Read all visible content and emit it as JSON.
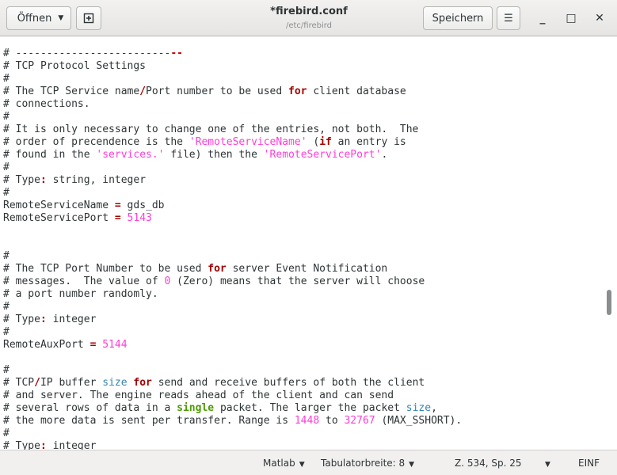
{
  "header": {
    "open_label": "Öffnen",
    "open_caret": "▼",
    "new_tab_icon": "new-document-icon",
    "title": "*firebird.conf",
    "subtitle": "/etc/firebird",
    "save_label": "Speichern",
    "menu_glyph": "☰",
    "minimize_glyph": "_",
    "maximize_glyph": "□",
    "close_glyph": "✕"
  },
  "editor": {
    "lines": [
      [
        {
          "t": "# -------------------------"
        },
        {
          "t": "--",
          "c": "kw-dash"
        }
      ],
      [
        {
          "t": "# TCP Protocol Settings"
        }
      ],
      [
        {
          "t": "#"
        }
      ],
      [
        {
          "t": "# The TCP Service name"
        },
        {
          "t": "/",
          "c": "op"
        },
        {
          "t": "Port number to be used "
        },
        {
          "t": "for",
          "c": "kw-red"
        },
        {
          "t": " client database"
        }
      ],
      [
        {
          "t": "# connections."
        }
      ],
      [
        {
          "t": "#"
        }
      ],
      [
        {
          "t": "# It is only necessary to change one of the entries, not both.  The"
        }
      ],
      [
        {
          "t": "# order of precendence is the "
        },
        {
          "t": "'RemoteServiceName'",
          "c": "str"
        },
        {
          "t": " ("
        },
        {
          "t": "if",
          "c": "kw-red"
        },
        {
          "t": " an entry is"
        }
      ],
      [
        {
          "t": "# found in the "
        },
        {
          "t": "'services.'",
          "c": "str"
        },
        {
          "t": " file) then the "
        },
        {
          "t": "'RemoteServicePort'",
          "c": "str"
        },
        {
          "t": "."
        }
      ],
      [
        {
          "t": "#"
        }
      ],
      [
        {
          "t": "# Type"
        },
        {
          "t": ":",
          "c": "op"
        },
        {
          "t": " string, integer"
        }
      ],
      [
        {
          "t": "#"
        }
      ],
      [
        {
          "t": "RemoteServiceName "
        },
        {
          "t": "=",
          "c": "op"
        },
        {
          "t": " gds_db"
        }
      ],
      [
        {
          "t": "RemoteServicePort "
        },
        {
          "t": "=",
          "c": "op"
        },
        {
          "t": " "
        },
        {
          "t": "5143",
          "c": "num"
        }
      ],
      [
        {
          "t": ""
        }
      ],
      [
        {
          "t": ""
        }
      ],
      [
        {
          "t": "#"
        }
      ],
      [
        {
          "t": "# The TCP Port Number to be used "
        },
        {
          "t": "for",
          "c": "kw-red"
        },
        {
          "t": " server Event Notification"
        }
      ],
      [
        {
          "t": "# messages.  The value of "
        },
        {
          "t": "0",
          "c": "num"
        },
        {
          "t": " (Zero) means that the server will choose"
        }
      ],
      [
        {
          "t": "# a port number randomly."
        }
      ],
      [
        {
          "t": "#"
        }
      ],
      [
        {
          "t": "# Type"
        },
        {
          "t": ":",
          "c": "op"
        },
        {
          "t": " integer"
        }
      ],
      [
        {
          "t": "#"
        }
      ],
      [
        {
          "t": "RemoteAuxPort "
        },
        {
          "t": "=",
          "c": "op"
        },
        {
          "t": " "
        },
        {
          "t": "5144",
          "c": "num"
        }
      ],
      [
        {
          "t": ""
        }
      ],
      [
        {
          "t": "#"
        }
      ],
      [
        {
          "t": "# TCP"
        },
        {
          "t": "/",
          "c": "op"
        },
        {
          "t": "IP buffer "
        },
        {
          "t": "size",
          "c": "kw-blue"
        },
        {
          "t": " "
        },
        {
          "t": "for",
          "c": "kw-red"
        },
        {
          "t": " send and receive buffers of both the client"
        }
      ],
      [
        {
          "t": "# and server. The engine reads ahead of the client and can send"
        }
      ],
      [
        {
          "t": "# several rows of data in a "
        },
        {
          "t": "single",
          "c": "kw-green"
        },
        {
          "t": " packet. The larger the packet "
        },
        {
          "t": "size",
          "c": "kw-blue"
        },
        {
          "t": ","
        }
      ],
      [
        {
          "t": "# the more data is sent per transfer. Range is "
        },
        {
          "t": "1448",
          "c": "num"
        },
        {
          "t": " to "
        },
        {
          "t": "32767",
          "c": "num"
        },
        {
          "t": " (MAX_SSHORT)."
        }
      ],
      [
        {
          "t": "#"
        }
      ],
      [
        {
          "t": "# Type"
        },
        {
          "t": ":",
          "c": "op"
        },
        {
          "t": " integer"
        }
      ]
    ]
  },
  "statusbar": {
    "language": "Matlab",
    "language_caret": "▼",
    "tab_width": "Tabulatorbreite: 8",
    "tab_caret": "▼",
    "position": "Z. 534, Sp. 25",
    "position_caret": "▼",
    "insert_mode": "EINF"
  }
}
